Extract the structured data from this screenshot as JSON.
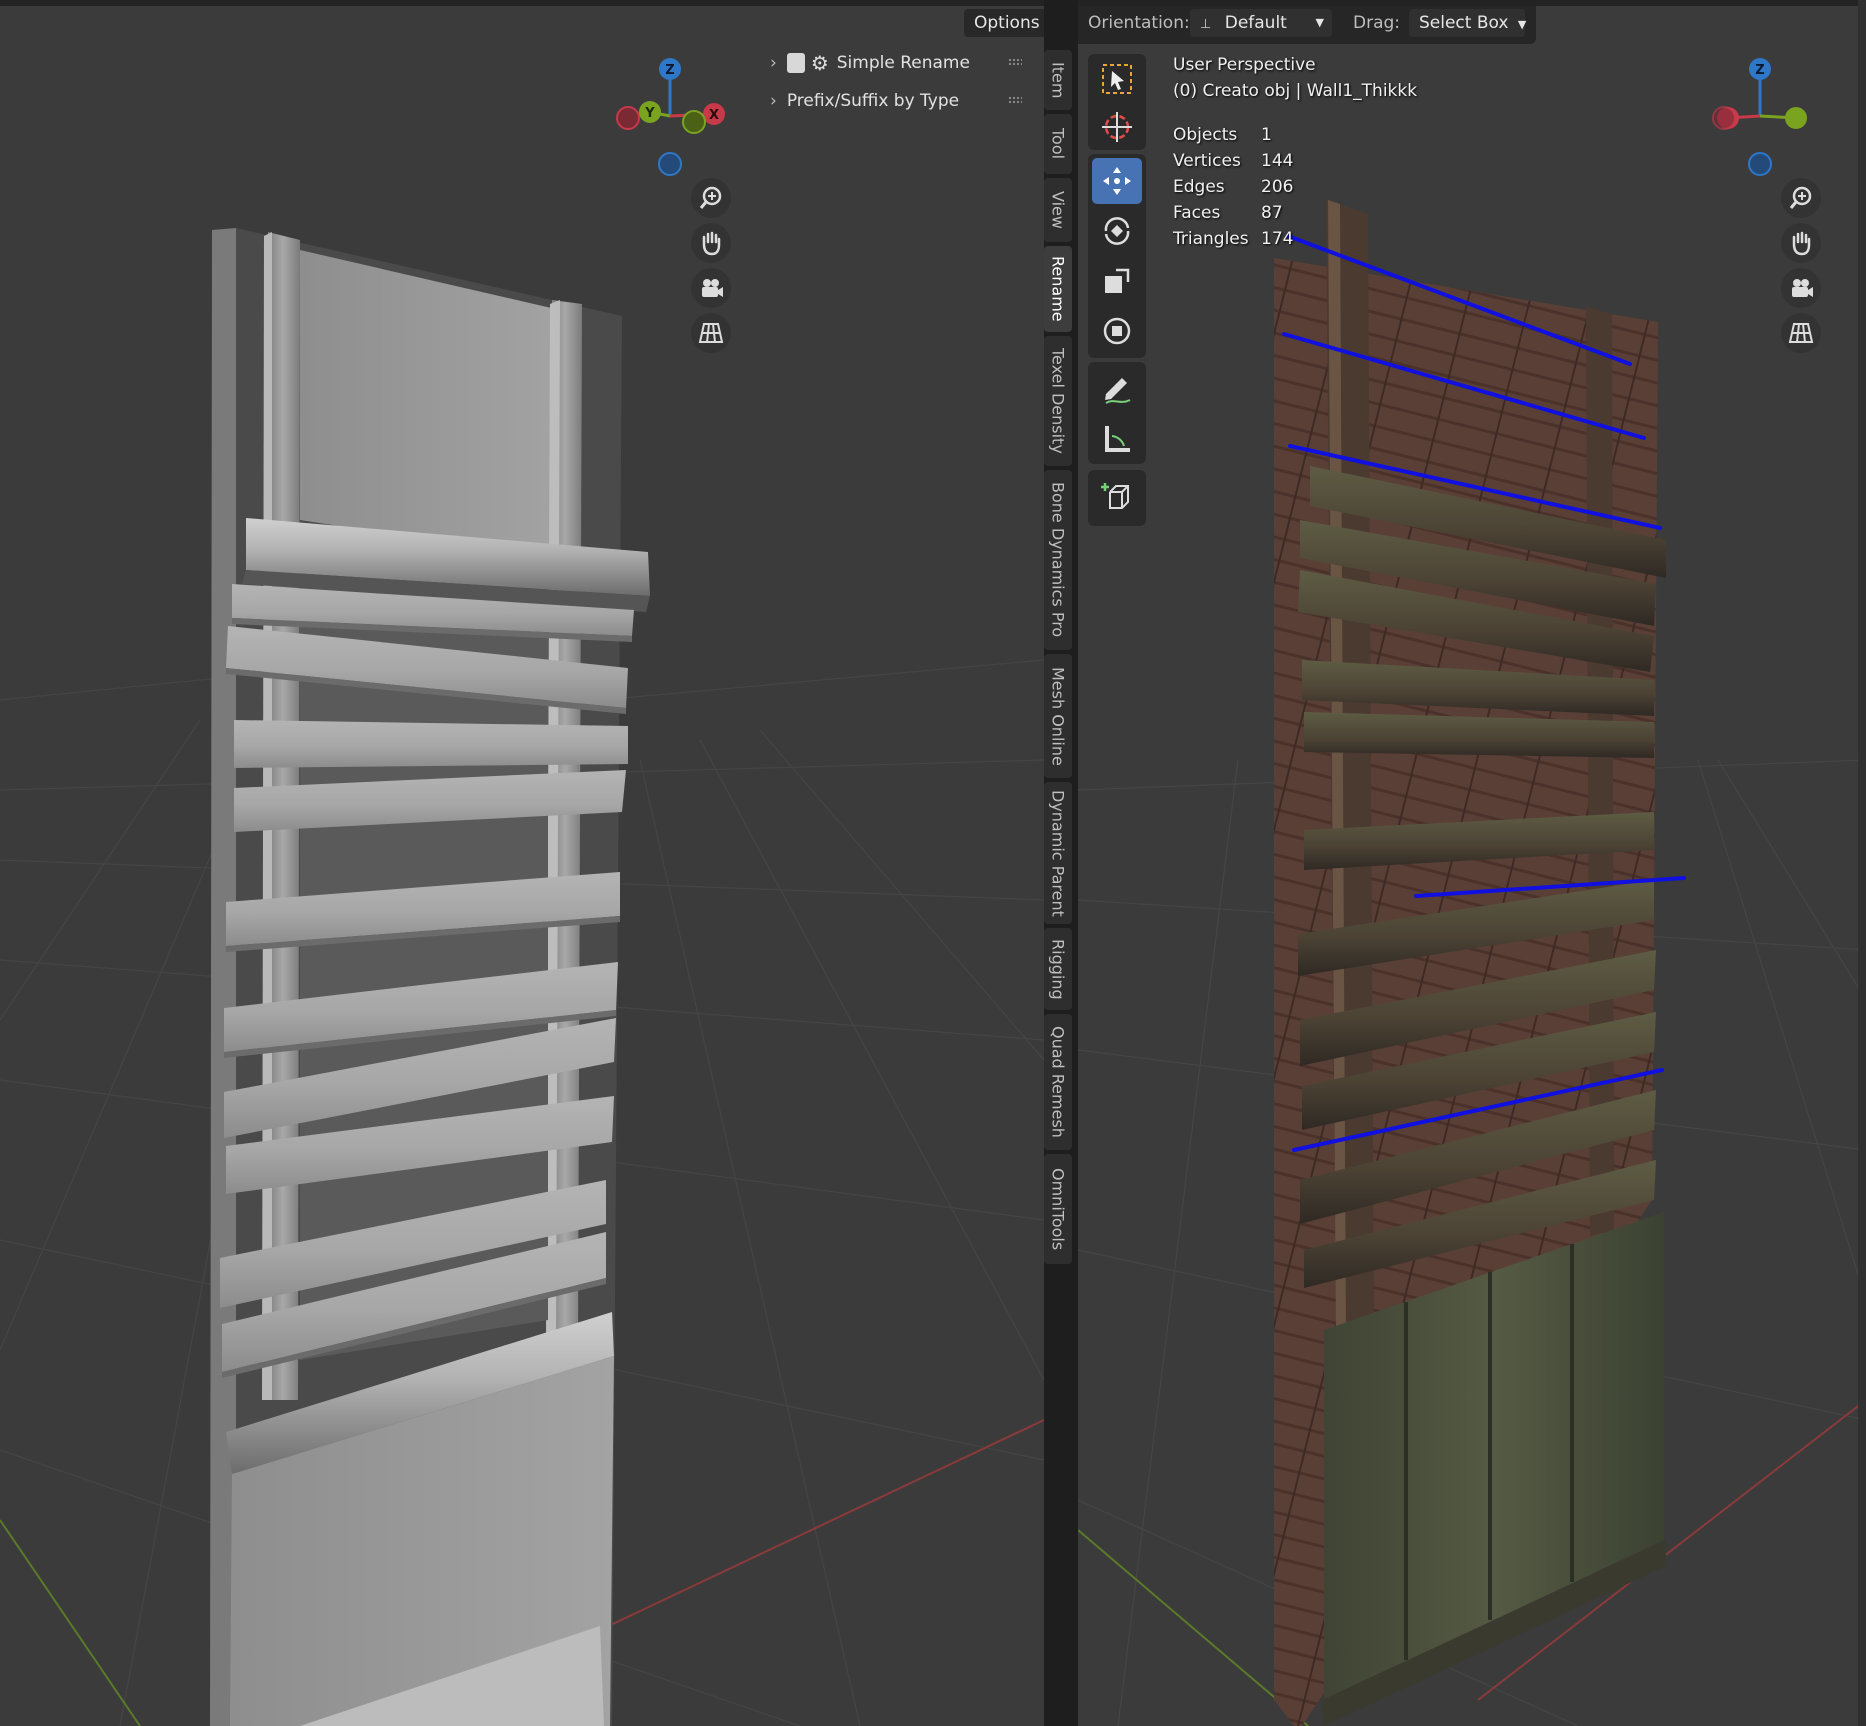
{
  "header": {
    "options_label": "Options",
    "orientation_label": "Orientation:",
    "orientation_value": "Default",
    "drag_label": "Drag:",
    "drag_value": "Select Box"
  },
  "npanel": {
    "items": [
      {
        "label": "Simple Rename"
      },
      {
        "label": "Prefix/Suffix by Type"
      }
    ],
    "tabs": [
      {
        "label": "Item"
      },
      {
        "label": "Tool"
      },
      {
        "label": "View"
      },
      {
        "label": "Rename"
      },
      {
        "label": "Texel Density"
      },
      {
        "label": "Bone Dynamics Pro"
      },
      {
        "label": "Mesh Online"
      },
      {
        "label": "Dynamic Parent"
      },
      {
        "label": "Rigging"
      },
      {
        "label": "Quad Remesh"
      },
      {
        "label": "OmniTools"
      }
    ],
    "active_tab": "Rename"
  },
  "viewport": {
    "view_name": "User Perspective",
    "object_line": "(0) Creato obj | Wall1_Thikkk",
    "stats": [
      {
        "label": "Objects",
        "value": "1"
      },
      {
        "label": "Vertices",
        "value": "144"
      },
      {
        "label": "Edges",
        "value": "206"
      },
      {
        "label": "Faces",
        "value": "87"
      },
      {
        "label": "Triangles",
        "value": "174"
      }
    ]
  },
  "gizmo": {
    "left_axes": [
      "Z",
      "Y",
      "X"
    ],
    "right_axes": [
      "Z"
    ]
  },
  "toolbar": {
    "tools": [
      "select-box",
      "cursor",
      "move",
      "rotate",
      "scale",
      "transform",
      "annotate",
      "measure",
      "add-cube"
    ],
    "active_tool": "move"
  },
  "colors": {
    "accent": "#4772b3",
    "axis_x": "#c8394a",
    "axis_y": "#7aa320",
    "axis_z": "#2f78c8",
    "annotation": "#1010e0"
  }
}
